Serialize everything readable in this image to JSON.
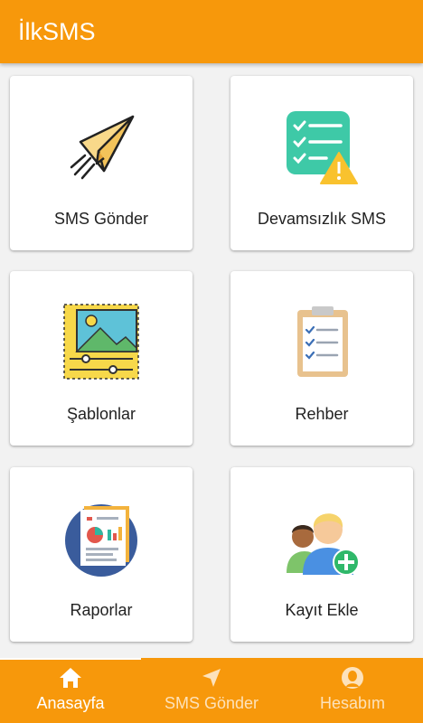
{
  "app": {
    "title": "İlkSMS"
  },
  "colors": {
    "primary": "#f7980b",
    "card": "#ffffff",
    "background": "#f2f2f2"
  },
  "menu": [
    {
      "label": "SMS Gönder",
      "icon": "paper-plane-icon"
    },
    {
      "label": "Devamsızlık SMS",
      "icon": "checklist-warning-icon"
    },
    {
      "label": "Şablonlar",
      "icon": "template-image-icon"
    },
    {
      "label": "Rehber",
      "icon": "clipboard-list-icon"
    },
    {
      "label": "Raporlar",
      "icon": "reports-icon"
    },
    {
      "label": "Kayıt Ekle",
      "icon": "add-user-icon"
    }
  ],
  "bottom_nav": [
    {
      "label": "Anasayfa",
      "icon": "home-icon",
      "active": true
    },
    {
      "label": "SMS Gönder",
      "icon": "navigation-arrow-icon",
      "active": false
    },
    {
      "label": "Hesabım",
      "icon": "account-icon",
      "active": false
    }
  ]
}
